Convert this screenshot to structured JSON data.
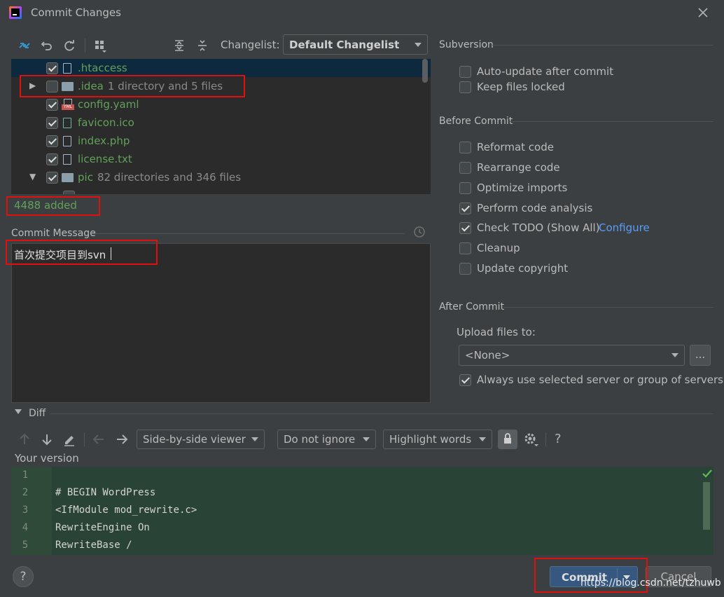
{
  "window": {
    "title": "Commit Changes",
    "close_icon": "close-icon",
    "app_icon": "intellij-icon"
  },
  "toolbar": {
    "icons": [
      "show-diff-icon",
      "rollback-icon",
      "refresh-icon",
      "group-by-icon",
      "expand-all-icon",
      "collapse-all-icon"
    ],
    "changelist_label": "Changelist:",
    "changelist_value": "Default Changelist"
  },
  "tree": {
    "rows": [
      {
        "name": ".htaccess",
        "checked": true,
        "kind": "file"
      },
      {
        "name": ".idea",
        "detail": "1 directory and 5 files",
        "checked": false,
        "kind": "folder",
        "expander": "▶"
      },
      {
        "name": "config.yaml",
        "checked": true,
        "kind": "yaml"
      },
      {
        "name": "favicon.ico",
        "checked": true,
        "kind": "file"
      },
      {
        "name": "index.php",
        "checked": true,
        "kind": "file"
      },
      {
        "name": "license.txt",
        "checked": true,
        "kind": "file"
      },
      {
        "name": "pic",
        "detail": "82 directories and 346 files",
        "checked": true,
        "kind": "folder",
        "expander": "▼"
      }
    ],
    "status": "4488 added"
  },
  "commit_message": {
    "label": "Commit Message",
    "value": "首次提交项目到svn"
  },
  "subversion": {
    "title": "Subversion",
    "options": [
      {
        "label": "Auto-update after commit",
        "checked": false
      },
      {
        "label": "Keep files locked",
        "checked": false
      }
    ]
  },
  "before_commit": {
    "title": "Before Commit",
    "options": [
      {
        "label": "Reformat code",
        "checked": false
      },
      {
        "label": "Rearrange code",
        "checked": false
      },
      {
        "label": "Optimize imports",
        "checked": false
      },
      {
        "label": "Perform code analysis",
        "checked": true
      },
      {
        "label": "Check TODO (Show All)",
        "checked": true,
        "link": "Configure"
      },
      {
        "label": "Cleanup",
        "checked": false
      },
      {
        "label": "Update copyright",
        "checked": false
      }
    ]
  },
  "after_commit": {
    "title": "After Commit",
    "upload_label": "Upload files to:",
    "upload_value": "<None>",
    "browse_label": "...",
    "always_use_label": "Always use selected server or group of servers",
    "always_use_checked": true
  },
  "diff": {
    "title": "Diff",
    "viewer": "Side-by-side viewer",
    "ignore": "Do not ignore",
    "highlight": "Highlight words",
    "help": "?",
    "your_version": "Your version",
    "lines": [
      {
        "n": "1",
        "text": ""
      },
      {
        "n": "2",
        "text": "# BEGIN WordPress"
      },
      {
        "n": "3",
        "text": "<IfModule mod_rewrite.c>"
      },
      {
        "n": "4",
        "text": "RewriteEngine On"
      },
      {
        "n": "5",
        "text": "RewriteBase /"
      }
    ]
  },
  "footer": {
    "help": "?",
    "commit": "Commit",
    "cancel": "Cancel",
    "watermark": "https://blog.csdn.net/tzhuwb"
  },
  "colors": {
    "accent": "#365880",
    "added_green": "#62a15a",
    "diff_bg": "#294436",
    "link": "#589df6",
    "highlight_box": "#e0100c"
  }
}
